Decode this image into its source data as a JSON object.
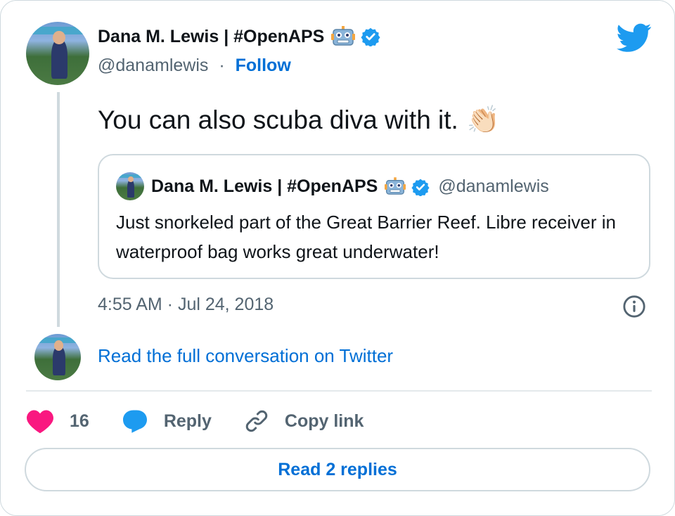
{
  "author": {
    "name": "Dana M. Lewis | #OpenAPS",
    "handle": "@danamlewis",
    "separator": "·",
    "follow_label": "Follow"
  },
  "tweet": {
    "text": "You can also scuba diva with it.",
    "emoji": "👏🏻",
    "timestamp": "4:55 AM · Jul 24, 2018"
  },
  "quoted": {
    "name": "Dana M. Lewis | #OpenAPS",
    "handle": "@danamlewis",
    "text": "Just snorkeled part of the Great Barrier Reef. Libre receiver in waterproof bag works great underwater!"
  },
  "links": {
    "read_full": "Read the full conversation on Twitter"
  },
  "actions": {
    "like_count": "16",
    "reply_label": "Reply",
    "copy_label": "Copy link",
    "read_replies": "Read 2 replies"
  },
  "colors": {
    "link_blue": "#006fd6",
    "twitter_blue": "#1d9bf0",
    "heart_pink": "#f91880",
    "muted": "#536471",
    "border": "#cfd9de"
  },
  "icons": [
    "twitter-bird-icon",
    "verified-badge-icon",
    "robot-emoji-icon",
    "clap-emoji-icon",
    "info-icon",
    "heart-icon",
    "reply-bubble-icon",
    "link-icon"
  ]
}
